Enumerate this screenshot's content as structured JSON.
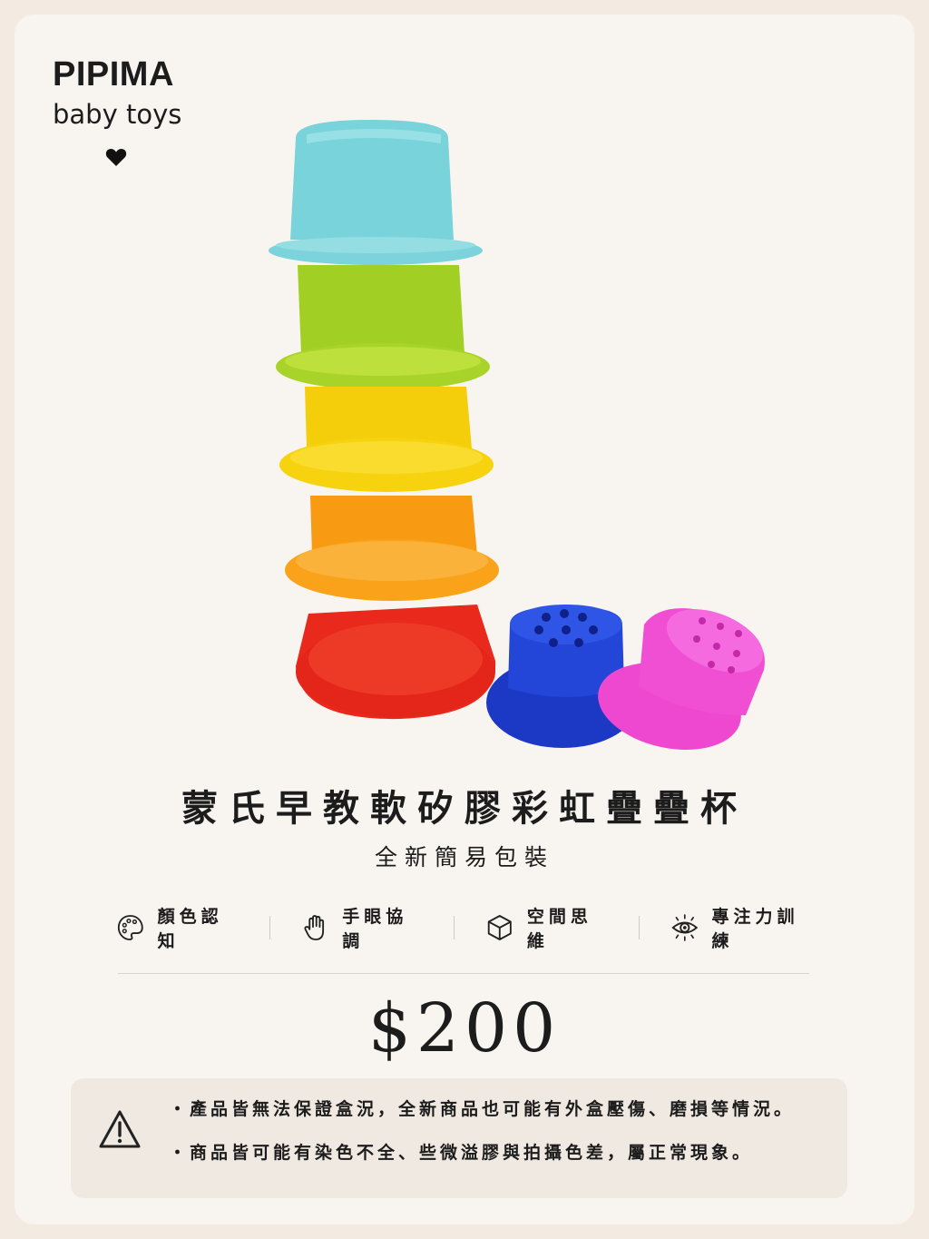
{
  "brand": {
    "name": "PIPIMA",
    "tagline": "baby toys"
  },
  "product": {
    "title": "蒙氏早教軟矽膠彩虹疊疊杯",
    "subtitle": "全新簡易包裝",
    "price": "$200",
    "image_icon": "rainbow-stacking-cups"
  },
  "features": [
    {
      "label": "顏色認知",
      "icon": "palette-icon"
    },
    {
      "label": "手眼協調",
      "icon": "hand-icon"
    },
    {
      "label": "空間思維",
      "icon": "cube-icon"
    },
    {
      "label": "專注力訓練",
      "icon": "eye-icon"
    }
  ],
  "notice": {
    "icon": "warning-icon",
    "lines": [
      "・產品皆無法保證盒況，全新商品也可能有外盒壓傷、磨損等情況。",
      "・商品皆可能有染色不全、些微溢膠與拍攝色差，屬正常現象。"
    ]
  },
  "colors": {
    "background": "#f3ebe2",
    "card": "#f8f5f1",
    "notice_bg": "#f0e9e2",
    "cup_teal": "#7fd6dd",
    "cup_green": "#a8d42a",
    "cup_yellow": "#f7d20f",
    "cup_orange": "#f9a21a",
    "cup_red": "#e8291c",
    "cup_blue": "#1f3fd0",
    "cup_pink": "#f04fd3"
  }
}
